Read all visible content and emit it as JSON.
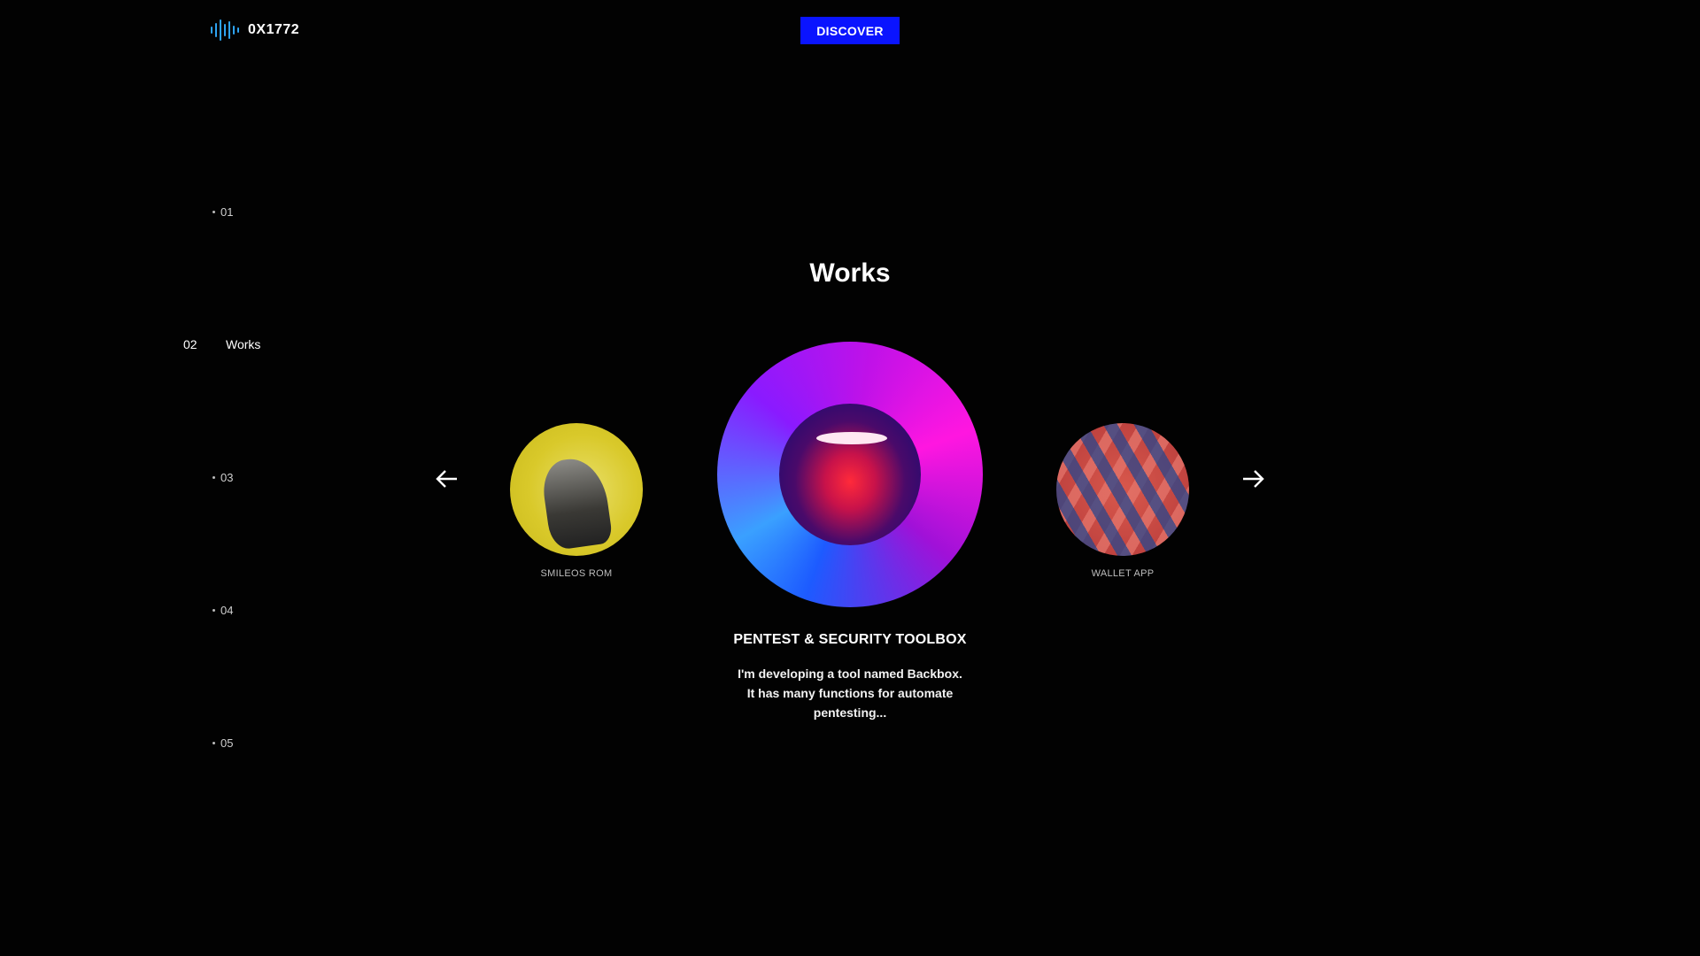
{
  "header": {
    "brand": "0X1772",
    "discover_label": "DISCOVER"
  },
  "side_nav": {
    "items": [
      {
        "num": "01",
        "label": ""
      },
      {
        "num": "02",
        "label": "Works"
      },
      {
        "num": "03",
        "label": ""
      },
      {
        "num": "04",
        "label": ""
      },
      {
        "num": "05",
        "label": ""
      }
    ],
    "active_index": 1
  },
  "section": {
    "title": "Works"
  },
  "carousel": {
    "prev_icon": "arrow-left-icon",
    "next_icon": "arrow-right-icon",
    "left_item": {
      "label": "SMILEOS ROM"
    },
    "right_item": {
      "label": "WALLET APP"
    },
    "feature": {
      "title": "PENTEST & SECURITY TOOLBOX",
      "description": "I'm developing a tool named Backbox. It has many functions for automate pentesting..."
    }
  },
  "colors": {
    "accent": "#0a14ff",
    "logo": "#2ea3f2",
    "background": "#020202"
  }
}
